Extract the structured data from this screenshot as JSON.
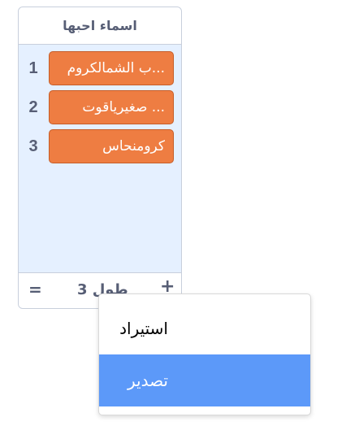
{
  "list_monitor": {
    "title": "اسماء احبها",
    "items": [
      {
        "index": "1",
        "value": "...ب الشمالكروم"
      },
      {
        "index": "2",
        "value": "... صغيرياقوت"
      },
      {
        "index": "3",
        "value": "كرومنحاس"
      }
    ],
    "footer": {
      "add_symbol": "+",
      "length_text": "طول 3",
      "resize_symbol": "="
    }
  },
  "context_menu": {
    "items": [
      {
        "label": "استيراد",
        "selected": false
      },
      {
        "label": "تصدير",
        "selected": true
      }
    ]
  },
  "colors": {
    "item_background": "#ee7d42",
    "list_background": "#e5f0ff",
    "menu_highlight": "#5c99f9"
  }
}
